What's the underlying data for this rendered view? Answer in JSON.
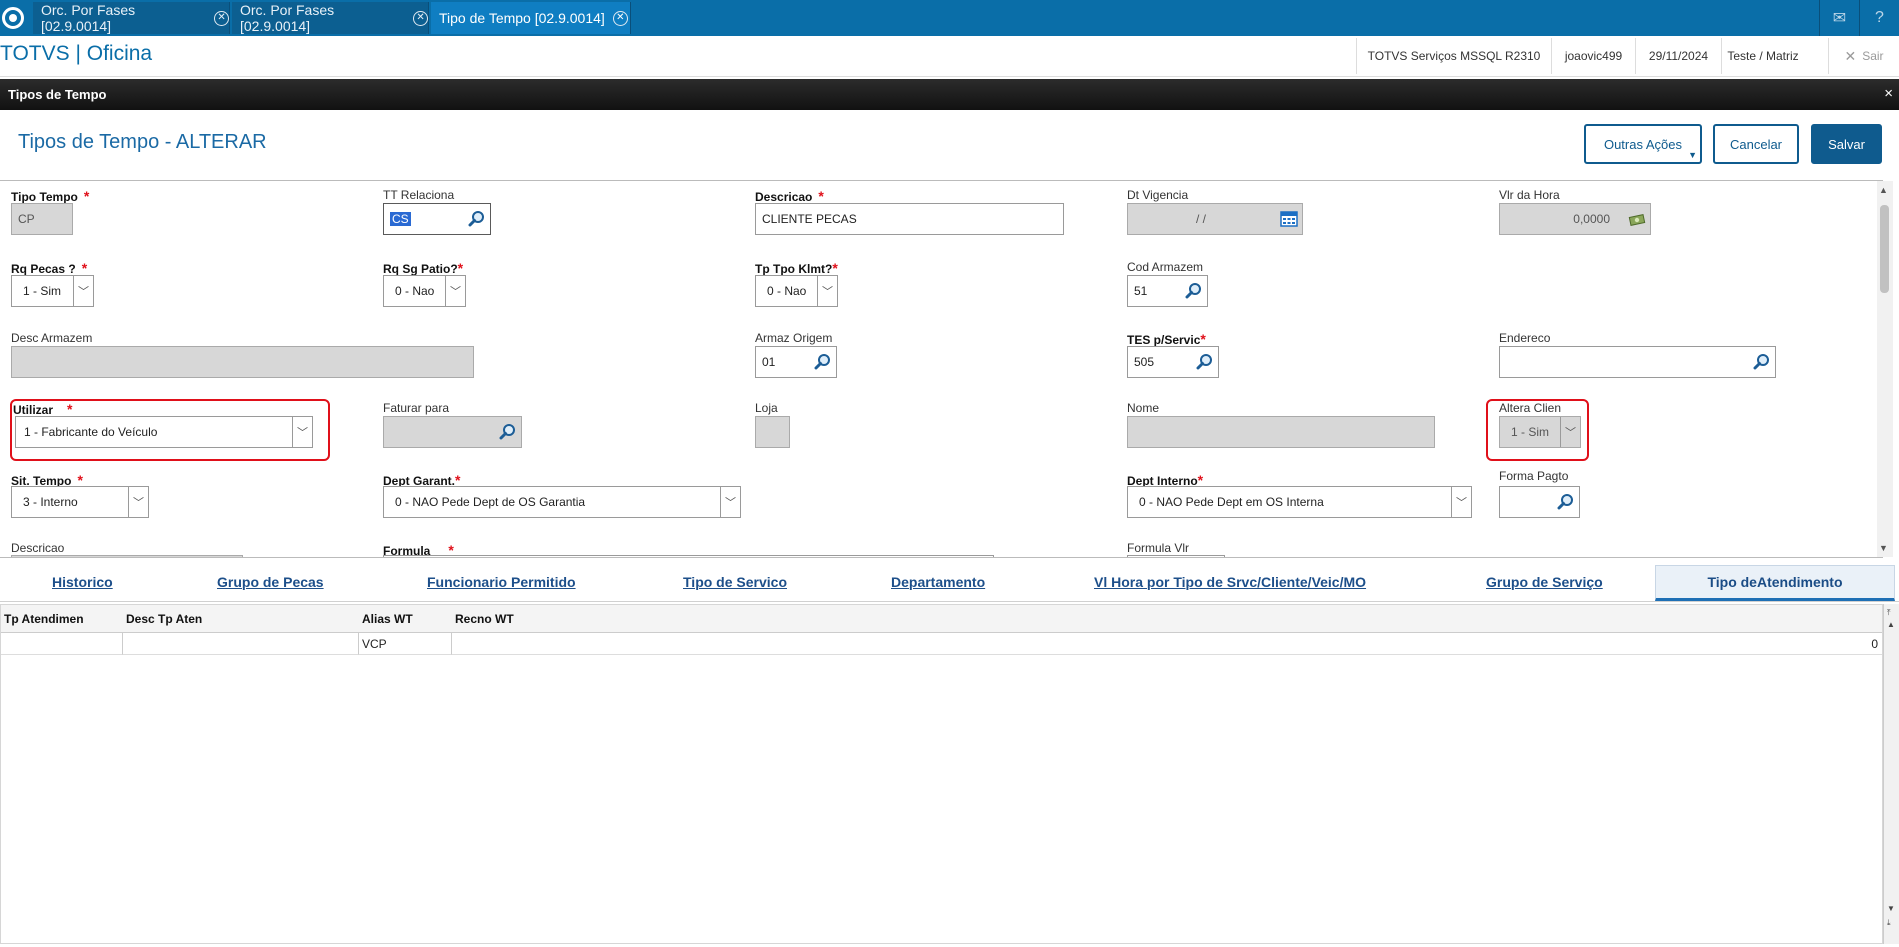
{
  "top_tabs": [
    {
      "label": "Orc. Por Fases [02.9.0014]"
    },
    {
      "label": "Orc. Por Fases [02.9.0014]"
    },
    {
      "label": "Tipo de Tempo [02.9.0014]"
    }
  ],
  "header": {
    "brand": "TOTVS | Oficina",
    "environment": "TOTVS Serviços MSSQL R2310",
    "user": "joaovic499",
    "date": "29/11/2024",
    "branch": "Teste / Matriz",
    "exit": "Sair"
  },
  "window": {
    "title": "Tipos de Tempo",
    "close": "×"
  },
  "page": {
    "title": "Tipos de Tempo - ALTERAR",
    "other_actions": "Outras Ações",
    "cancel": "Cancelar",
    "save": "Salvar"
  },
  "form": {
    "tipo_tempo": {
      "label": "Tipo Tempo",
      "value": "CP"
    },
    "tt_relaciona": {
      "label": "TT Relaciona",
      "value": "CS"
    },
    "descricao": {
      "label": "Descricao",
      "value": "CLIENTE PECAS"
    },
    "dt_vigencia": {
      "label": "Dt Vigencia",
      "value": "/ /"
    },
    "vlr_hora": {
      "label": "Vlr da Hora",
      "value": "0,0000"
    },
    "rq_pecas": {
      "label": "Rq Pecas ?",
      "value": "1 - Sim"
    },
    "rq_sg_patio": {
      "label": "Rq Sg Patio?",
      "value": "0 - Nao"
    },
    "tp_tpo_klmt": {
      "label": "Tp Tpo Klmt?",
      "value": "0 - Nao"
    },
    "cod_armazem": {
      "label": "Cod Armazem",
      "value": "51"
    },
    "desc_armazem": {
      "label": "Desc Armazem",
      "value": ""
    },
    "armaz_origem": {
      "label": "Armaz Origem",
      "value": "01"
    },
    "tes_servic": {
      "label": "TES p/Servic",
      "value": "505"
    },
    "endereco": {
      "label": "Endereco",
      "value": ""
    },
    "utilizar": {
      "label": "Utilizar",
      "value": "1 - Fabricante do Veículo"
    },
    "faturar_para": {
      "label": "Faturar para",
      "value": ""
    },
    "loja": {
      "label": "Loja",
      "value": ""
    },
    "nome": {
      "label": "Nome",
      "value": ""
    },
    "altera_clien": {
      "label": "Altera Clien",
      "value": "1 - Sim"
    },
    "sit_tempo": {
      "label": "Sit. Tempo",
      "value": "3 - Interno"
    },
    "dept_garant": {
      "label": "Dept Garant.",
      "value": "0 - NAO Pede Dept de OS Garantia"
    },
    "dept_interno": {
      "label": "Dept Interno",
      "value": "0 - NAO Pede Dept em OS Interna"
    },
    "forma_pagto": {
      "label": "Forma Pagto",
      "value": ""
    },
    "descricao2": {
      "label": "Descricao"
    },
    "formula": {
      "label": "Formula"
    },
    "formula_vlr": {
      "label": "Formula Vlr"
    },
    "required_mark": "*"
  },
  "bottom_tabs": [
    {
      "label": "Historico"
    },
    {
      "label": "Grupo de Pecas"
    },
    {
      "label": "Funcionario Permitido"
    },
    {
      "label": "Tipo de Servico"
    },
    {
      "label": "Departamento"
    },
    {
      "label": "Vl Hora por Tipo de Srvc/Cliente/Veic/MO"
    },
    {
      "label": "Grupo de Serviço"
    },
    {
      "label": "Tipo deAtendimento"
    }
  ],
  "grid": {
    "columns": [
      "Tp Atendimen",
      "Desc Tp Aten",
      "Alias WT",
      "Recno WT"
    ],
    "rows": [
      [
        "",
        "",
        "VCP",
        "0"
      ]
    ]
  },
  "icons": {
    "mail": "mail-icon",
    "help": "help-icon",
    "search": "magnifier-icon",
    "calendar": "calendar-icon",
    "money": "money-icon"
  }
}
